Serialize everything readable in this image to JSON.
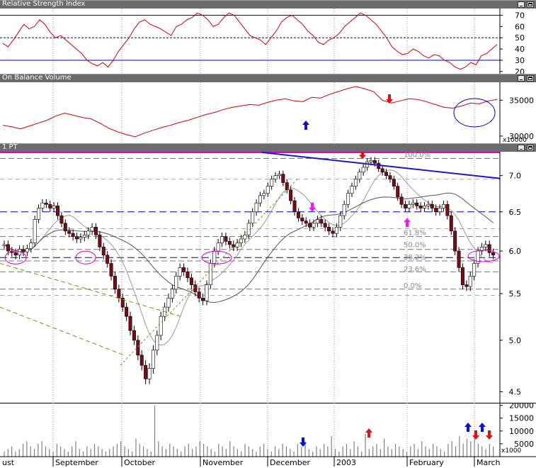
{
  "panels": {
    "rsi": {
      "title": "Relative Strength Index"
    },
    "obv": {
      "title": "On Balance Volume"
    },
    "price": {
      "title": "1 PT"
    }
  },
  "axes": {
    "rsi_ticks": [
      "70",
      "60",
      "50",
      "40",
      "30",
      "20"
    ],
    "obv_ticks": [
      "35000",
      "30000"
    ],
    "obv_multiplier": "x10000",
    "price_ticks": [
      "7.0",
      "6.5",
      "6.0",
      "5.5",
      "5.0",
      "4.5"
    ],
    "volume_ticks": [
      "20000",
      "15000",
      "10000",
      "5000"
    ],
    "volume_multiplier": "x1000",
    "months": [
      "ust",
      "September",
      "October",
      "November",
      "December",
      "2003",
      "February",
      "March"
    ]
  },
  "fib_labels": [
    "100.0%",
    "61.8%",
    "50.0%",
    "38.2%",
    "23.6%",
    "0.0%"
  ],
  "colors": {
    "up": "#ffffff",
    "down": "#7a0a14",
    "outline": "#000000",
    "rsi_line": "#d40000",
    "blue_line": "#0000cc",
    "magenta": "#e000c8",
    "arrow_red": "#e01010",
    "arrow_blue": "#0010e0",
    "arrow_magenta": "#ff10ff",
    "trend_blue": "#1818d0",
    "olive": "#8a8a10"
  },
  "chart_data": {
    "type": "candlestick",
    "title": "1 PT",
    "x_periods": [
      "ust",
      "September",
      "October",
      "November",
      "December",
      "2003",
      "February",
      "March"
    ],
    "price_ylim": [
      4.4,
      7.35
    ],
    "price_log_scale": true,
    "rsi_ylim": [
      18,
      76
    ],
    "rsi_levels": [
      70,
      50,
      30
    ],
    "obv_ylim": [
      29000,
      37500
    ],
    "volume_ylim": [
      0,
      21000
    ],
    "fib_levels": {
      "100.0%": 7.25,
      "61.8%": 6.18,
      "50.0%": 6.02,
      "38.2%": 5.88,
      "23.6%": 5.75,
      "0.0%": 5.55
    },
    "horizontal_lines": [
      7.25,
      6.5,
      5.92
    ],
    "grid": true,
    "points_per_day_note": "daily",
    "closes": [
      6.08,
      6.0,
      5.98,
      5.95,
      6.02,
      5.99,
      6.03,
      6.1,
      6.4,
      6.55,
      6.62,
      6.6,
      6.55,
      6.58,
      6.45,
      6.35,
      6.25,
      6.22,
      6.18,
      6.15,
      6.17,
      6.2,
      6.25,
      6.3,
      6.2,
      6.05,
      5.95,
      5.85,
      5.7,
      5.55,
      5.45,
      5.35,
      5.25,
      5.1,
      5.0,
      4.85,
      4.75,
      4.62,
      4.72,
      4.9,
      5.05,
      5.25,
      5.35,
      5.45,
      5.55,
      5.7,
      5.8,
      5.75,
      5.68,
      5.6,
      5.52,
      5.45,
      5.42,
      5.6,
      5.85,
      6.0,
      6.1,
      6.18,
      6.12,
      6.08,
      6.05,
      6.1,
      6.15,
      6.2,
      6.35,
      6.5,
      6.62,
      6.72,
      6.75,
      6.85,
      6.95,
      7.0,
      7.02,
      6.9,
      6.8,
      6.65,
      6.5,
      6.42,
      6.38,
      6.35,
      6.3,
      6.35,
      6.4,
      6.35,
      6.3,
      6.25,
      6.22,
      6.3,
      6.45,
      6.6,
      6.75,
      6.85,
      6.95,
      7.05,
      7.12,
      7.2,
      7.22,
      7.18,
      7.1,
      7.05,
      7.0,
      6.95,
      6.85,
      6.7,
      6.6,
      6.55,
      6.6,
      6.62,
      6.58,
      6.55,
      6.58,
      6.6,
      6.55,
      6.5,
      6.55,
      6.6,
      6.45,
      6.25,
      6.0,
      5.8,
      5.6,
      5.58,
      5.7,
      5.85,
      6.0,
      6.05,
      6.08,
      5.98,
      5.95
    ],
    "volume": [
      2,
      3,
      4,
      2,
      3,
      5,
      6,
      4,
      3,
      5,
      6,
      4,
      3,
      2,
      5,
      4,
      3,
      2,
      4,
      6,
      3,
      2,
      4,
      3,
      5,
      4,
      3,
      2,
      3,
      4,
      5,
      6,
      4,
      3,
      2,
      7,
      5,
      4,
      3,
      2,
      20,
      6,
      4,
      3,
      5,
      4,
      3,
      2,
      4,
      5,
      3,
      4,
      6,
      5,
      4,
      3,
      2,
      5,
      4,
      3,
      6,
      4,
      3,
      2,
      5,
      4,
      3,
      2,
      4,
      5,
      3,
      2,
      4,
      3,
      5,
      4,
      3,
      2,
      5,
      4,
      6,
      3,
      2,
      4,
      3,
      5,
      4,
      8,
      3,
      2,
      4,
      5,
      3,
      6,
      4,
      2,
      9,
      3,
      4,
      5,
      3,
      7,
      4,
      3,
      5,
      4,
      3,
      2,
      4,
      5,
      3,
      6,
      4,
      3,
      5,
      4,
      3,
      2,
      5,
      6,
      4,
      8,
      5,
      7,
      6,
      9,
      5,
      4,
      3,
      5,
      4
    ],
    "rsi": [
      45,
      42,
      48,
      55,
      62,
      58,
      60,
      66,
      62,
      55,
      50,
      52,
      48,
      44,
      40,
      36,
      30,
      27,
      25,
      28,
      24,
      30,
      38,
      44,
      50,
      58,
      64,
      66,
      62,
      60,
      58,
      55,
      52,
      60,
      62,
      66,
      68,
      72,
      70,
      66,
      60,
      62,
      68,
      72,
      70,
      64,
      58,
      52,
      50,
      48,
      44,
      50,
      56,
      64,
      68,
      70,
      66,
      62,
      56,
      52,
      46,
      44,
      48,
      50,
      54,
      60,
      64,
      68,
      72,
      70,
      66,
      62,
      56,
      50,
      42,
      38,
      35,
      36,
      40,
      38,
      34,
      32,
      35,
      34,
      30,
      28,
      24,
      22,
      24,
      28,
      26,
      34,
      36,
      40,
      44
    ],
    "obv": [
      31.5,
      31.3,
      31.0,
      31.4,
      31.8,
      32.2,
      32.8,
      33.2,
      32.9,
      32.6,
      32.4,
      31.8,
      31.1,
      30.6,
      30.2,
      29.9,
      30.4,
      30.8,
      31.2,
      31.5,
      31.9,
      32.2,
      32.6,
      33.0,
      33.3,
      33.7,
      34.0,
      34.2,
      34.4,
      34.3,
      34.7,
      35.0,
      35.2,
      34.9,
      34.8,
      35.4,
      35.3,
      35.8,
      36.2,
      36.6,
      36.9,
      36.6,
      36.2,
      35.0,
      34.6,
      34.9,
      35.2,
      35.1,
      34.8,
      34.4,
      34.0,
      33.9,
      34.2,
      34.6,
      34.5,
      34.9,
      35.1
    ]
  }
}
